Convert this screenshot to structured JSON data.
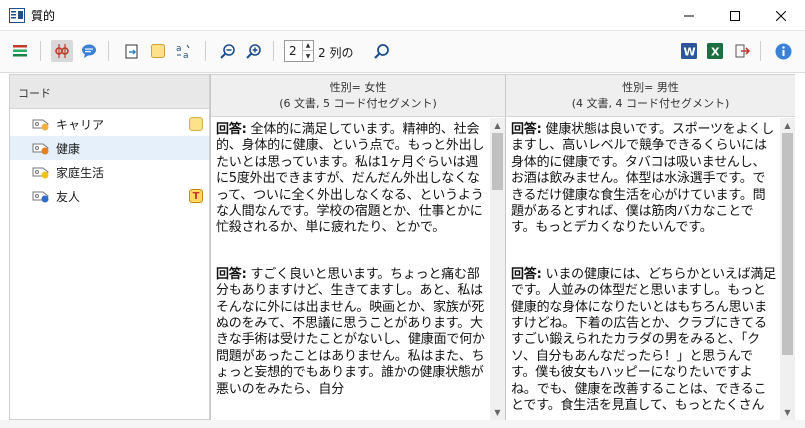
{
  "window": {
    "title": "質的"
  },
  "codes_panel": {
    "header": "コード",
    "items": [
      {
        "label": "キャリア",
        "dot_color": "#f5b041",
        "badge": "memo"
      },
      {
        "label": "健康",
        "dot_color": "#e67e22",
        "badge": ""
      },
      {
        "label": "家庭生活",
        "dot_color": "#f1c40f",
        "badge": ""
      },
      {
        "label": "友人",
        "dot_color": "#2e6cc7",
        "badge": "T"
      }
    ]
  },
  "toolbar": {
    "columns_value": "2",
    "columns_label": "2 列の"
  },
  "columns": [
    {
      "header_line1": "性別= 女性",
      "header_line2": "(6 文書, 5 コード付セグメント)",
      "segments": [
        {
          "label": "回答:",
          "text": " 全体的に満足しています。精神的、社会的、身体的に健康、という点で。もっと外出したいとは思っています。私は1ヶ月ぐらいは週に5度外出できますが、だんだん外出しなくなって、ついに全く外出しなくなる、というような人間なんです。学校の宿題とか、仕事とかに忙殺されるか、単に疲れたり、とかで。"
        },
        {
          "label": "回答:",
          "text": " すごく良いと思います。ちょっと痛む部分もありますけど、生きてますし。あと、私はそんなに外には出ません。映画とか、家族が死ぬのをみて、不思議に思うことがあります。大きな手術は受けたことがないし、健康面で何か問題があったことはありません。私はまた、ちょっと妄想的でもあります。誰かの健康状態が悪いのをみたら、自分"
        }
      ]
    },
    {
      "header_line1": "性別= 男性",
      "header_line2": "(4 文書, 4 コード付セグメント)",
      "segments": [
        {
          "label": "回答:",
          "text": " 健康状態は良いです。スポーツをよくしますし、高いレベルで競争できるくらいには身体的に健康です。タバコは吸いませんし、お酒は飲みません。体型は水泳選手です。できるだけ健康な食生活を心がけています。問題があるとすれば、僕は筋肉バカなことです。もっとデカくなりたいんです。"
        },
        {
          "label": "回答:",
          "text": " いまの健康には、どちらかといえば満足です。人並みの体型だと思いますし。もっと健康的な身体になりたいとはもちろん思いますけどね。下着の広告とか、クラブにきてるすごい鍛えられたカラダの男をみると、「クソ、自分もあんなだったら！」と思うんです。僕も彼女もハッピーになりたいですよね。でも、健康を改善することは、できることです。食生活を見直して、もっとたくさん"
        }
      ]
    }
  ]
}
